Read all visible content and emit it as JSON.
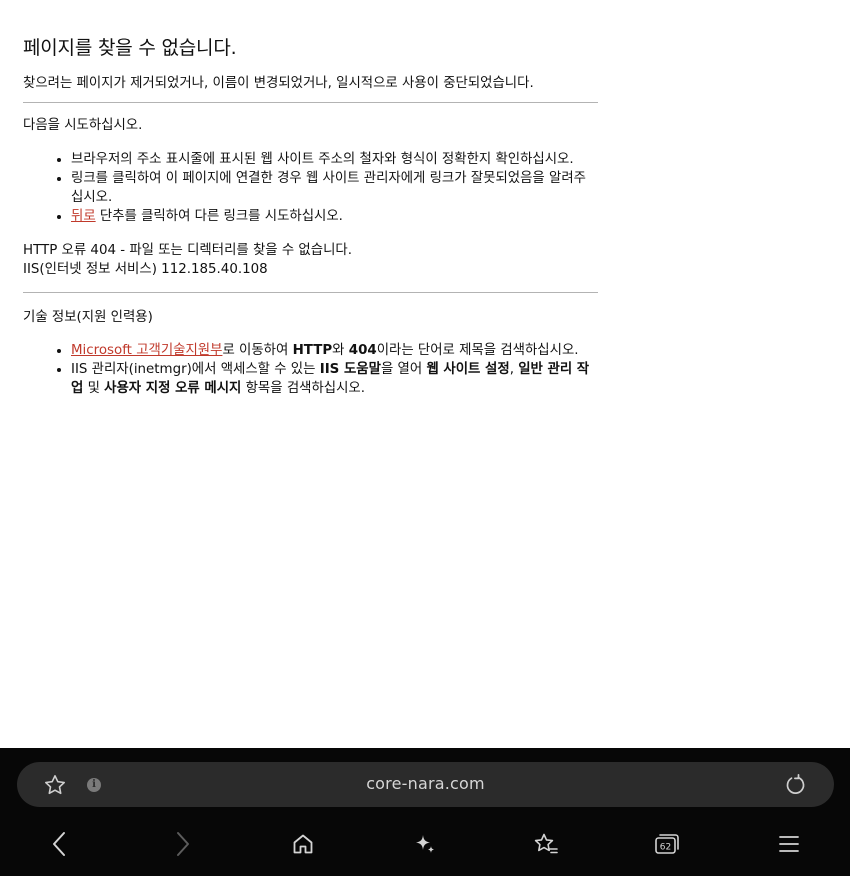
{
  "error": {
    "title": "페이지를 찾을 수 없습니다.",
    "subtitle": "찾으려는 페이지가 제거되었거나, 이름이 변경되었거나, 일시적으로 사용이 중단되었습니다.",
    "try_label": "다음을 시도하십시오.",
    "suggestions": {
      "item1": "브라우저의 주소 표시줄에 표시된 웹 사이트 주소의 철자와 형식이 정확한지 확인하십시오.",
      "item2": "링크를 클릭하여 이 페이지에 연결한 경우 웹 사이트 관리자에게 링크가 잘못되었음을 알려주십시오.",
      "back_link": "뒤로",
      "item3_rest": " 단추를 클릭하여 다른 링크를 시도하십시오."
    },
    "http_line": "HTTP 오류 404 - 파일 또는 디렉터리를 찾을 수 없습니다.",
    "iis_line": "IIS(인터넷 정보 서비스) 112.185.40.108",
    "tech_label": "기술 정보(지원 인력용)",
    "tech_items": {
      "ms_link": "Microsoft 고객기술지원부",
      "t1_a": "로 이동하여 ",
      "t1_http": "HTTP",
      "t1_b": "와 ",
      "t1_404": "404",
      "t1_c": "이라는 단어로 제목을 검색하십시오.",
      "t2_a": "IIS 관리자(inetmgr)에서 액세스할 수 있는 ",
      "t2_help": "IIS 도움말",
      "t2_b": "을 열어 ",
      "t2_site": "웹 사이트 설정",
      "t2_c": ", ",
      "t2_admin": "일반 관리 작업",
      "t2_d": " 및 ",
      "t2_custom": "사용자 지정 오류 메시지",
      "t2_e": " 항목을 검색하십시오."
    }
  },
  "browser": {
    "url": "core-nara.com",
    "info_glyph": "i",
    "tab_count": "62",
    "icons": [
      "bookmark-star-icon",
      "info-icon",
      "reload-icon",
      "back-icon",
      "forward-icon",
      "home-icon",
      "sparkle-icon",
      "bookmarks-icon",
      "tabs-icon",
      "menu-icon"
    ]
  }
}
